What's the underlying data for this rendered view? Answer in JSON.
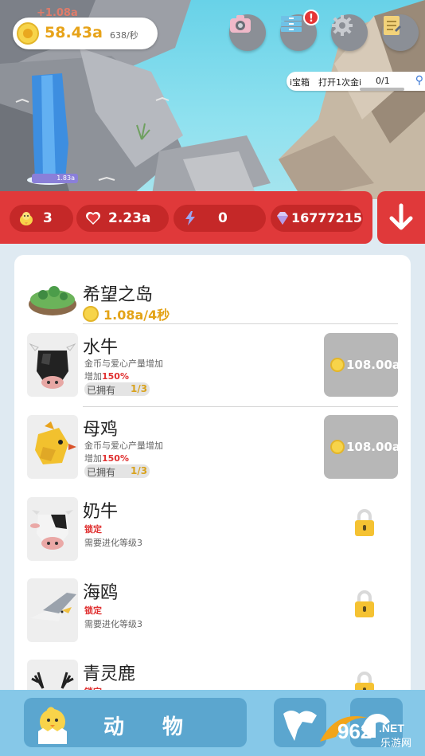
{
  "hud": {
    "coins": "58.43a",
    "coin_rate": "638/秒",
    "floating_gain": "+1.08a",
    "notification_badge": "!",
    "waterfall_label": "1.83a"
  },
  "chest": {
    "text": "i宝箱　打开1次金i",
    "count": "0/1"
  },
  "stats": {
    "chicks": "3",
    "hearts": "2.23a",
    "energy": "0",
    "diamonds": "16777215"
  },
  "island": {
    "name": "希望之岛",
    "rate": "1.08a/4秒"
  },
  "animals": [
    {
      "name": "水牛",
      "desc": "金币与爱心产量增加",
      "boost_prefix": "增加",
      "boost": "150%",
      "owned_label": "已拥有",
      "owned_count": "1/3",
      "price": "108.00a"
    },
    {
      "name": "母鸡",
      "desc": "金币与爱心产量增加",
      "boost_prefix": "增加",
      "boost": "150%",
      "owned_label": "已拥有",
      "owned_count": "1/3",
      "price": "108.00a"
    },
    {
      "name": "奶牛",
      "state": "锁定",
      "req": "需要进化等级3"
    },
    {
      "name": "海鸥",
      "state": "锁定",
      "req": "需要进化等级3"
    },
    {
      "name": "青灵鹿",
      "state": "锁定"
    }
  ],
  "nav": {
    "animals_tab": "动物"
  },
  "watermark": {
    "brand": "962",
    "suffix": ".NET",
    "sub": "乐游网"
  },
  "colors": {
    "red_bar": "#e0393a",
    "gold": "#e3a317",
    "nav_blue": "#86c8e8"
  }
}
